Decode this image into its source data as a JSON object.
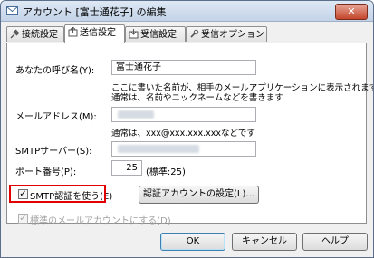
{
  "window": {
    "title": "アカウント [富士通花子] の編集",
    "close_label": "✕"
  },
  "tabs": [
    {
      "label": "接続設定",
      "active": false
    },
    {
      "label": "送信設定",
      "active": true
    },
    {
      "label": "受信設定",
      "active": false
    },
    {
      "label": "受信オプション",
      "active": false
    }
  ],
  "form": {
    "name_label": "あなたの呼び名(Y):",
    "name_value": "富士通花子",
    "name_note_line1": "ここに書いた名前が、相手のメールアプリケーションに表示されます",
    "name_note_line2": "通常は、名前やニックネームなどを書きます",
    "email_label": "メールアドレス(M):",
    "email_note": "通常は、xxx@xxx.xxx.xxxなどです",
    "smtp_label": "SMTPサーバー(S):",
    "port_label": "ポート番号(P):",
    "port_value": "25",
    "port_standard": "(標準:25)",
    "smtp_auth_label": "SMTP認証を使う(E)",
    "smtp_auth_checked": true,
    "auth_account_button": "認証アカウントの設定(L)...",
    "default_account_label": "標準のメールアカウントにする(D)",
    "default_account_checked": true
  },
  "buttons": {
    "ok": "OK",
    "cancel": "キャンセル",
    "help": "ヘルプ"
  },
  "colors": {
    "highlight": "#e00000"
  }
}
